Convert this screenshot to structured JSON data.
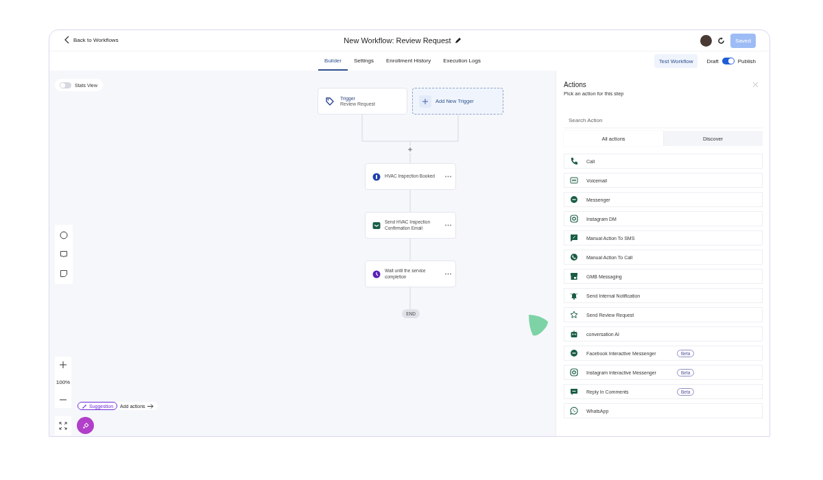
{
  "header": {
    "back_link": "Back to Workflows",
    "title": "New Workflow: Review Request",
    "saved_button": {
      "label": "Saved",
      "disabled": true
    }
  },
  "tabs": [
    {
      "label": "Builder",
      "selected": true
    },
    {
      "label": "Settings",
      "selected": false
    },
    {
      "label": "Enrollment History",
      "selected": false
    },
    {
      "label": "Execution Logs",
      "selected": false
    }
  ],
  "test_button": "Test Workflow",
  "publish_toggle": {
    "off_label": "Draft",
    "on_label": "Publish",
    "on": true
  },
  "canvas": {
    "stats_view": {
      "label": "Stats View",
      "on": false
    },
    "trigger": {
      "title": "Trigger",
      "value": "Review Request"
    },
    "add_trigger": "Add New Trigger",
    "steps": [
      {
        "text": "HVAC Inspection Booked",
        "kind": "event",
        "color": "#1e3fae"
      },
      {
        "text": "Send HVAC Inspection Confirmation Email",
        "kind": "email",
        "color": "#1b5e45"
      },
      {
        "text": "Wait until the service completion",
        "kind": "wait",
        "color": "#5b21b6"
      }
    ],
    "end": "END",
    "zoom": "100%",
    "suggestion": {
      "badge": "Suggestion",
      "link": "Add actions"
    }
  },
  "actions_panel": {
    "title": "Actions",
    "subtitle": "Pick an action for this step",
    "search": {
      "placeholder": "Search Action"
    },
    "tabs": [
      {
        "label": "All actions",
        "selected": true
      },
      {
        "label": "Discover",
        "selected": false
      }
    ],
    "items": [
      {
        "name": "Call",
        "kind": "phone"
      },
      {
        "name": "Voicemail",
        "kind": "voicemail"
      },
      {
        "name": "Messenger",
        "kind": "messenger"
      },
      {
        "name": "Instagram DM",
        "kind": "instagram"
      },
      {
        "name": "Manual Action To SMS",
        "kind": "sms"
      },
      {
        "name": "Manual Action To Call",
        "kind": "call"
      },
      {
        "name": "GMB Messaging",
        "kind": "gmb"
      },
      {
        "name": "Send Internal Notification",
        "kind": "bell"
      },
      {
        "name": "Send Review Request",
        "kind": "star"
      },
      {
        "name": "conversation AI",
        "kind": "robot"
      },
      {
        "name": "Facebook Interactive  Messenger",
        "kind": "messenger",
        "badge": "Beta"
      },
      {
        "name": "Instagram Interactive Messenger",
        "kind": "instagram",
        "badge": "Beta"
      },
      {
        "name": "Reply In Comments",
        "kind": "comment",
        "badge": "Beta"
      },
      {
        "name": "WhatsApp",
        "kind": "whatsapp"
      }
    ]
  }
}
